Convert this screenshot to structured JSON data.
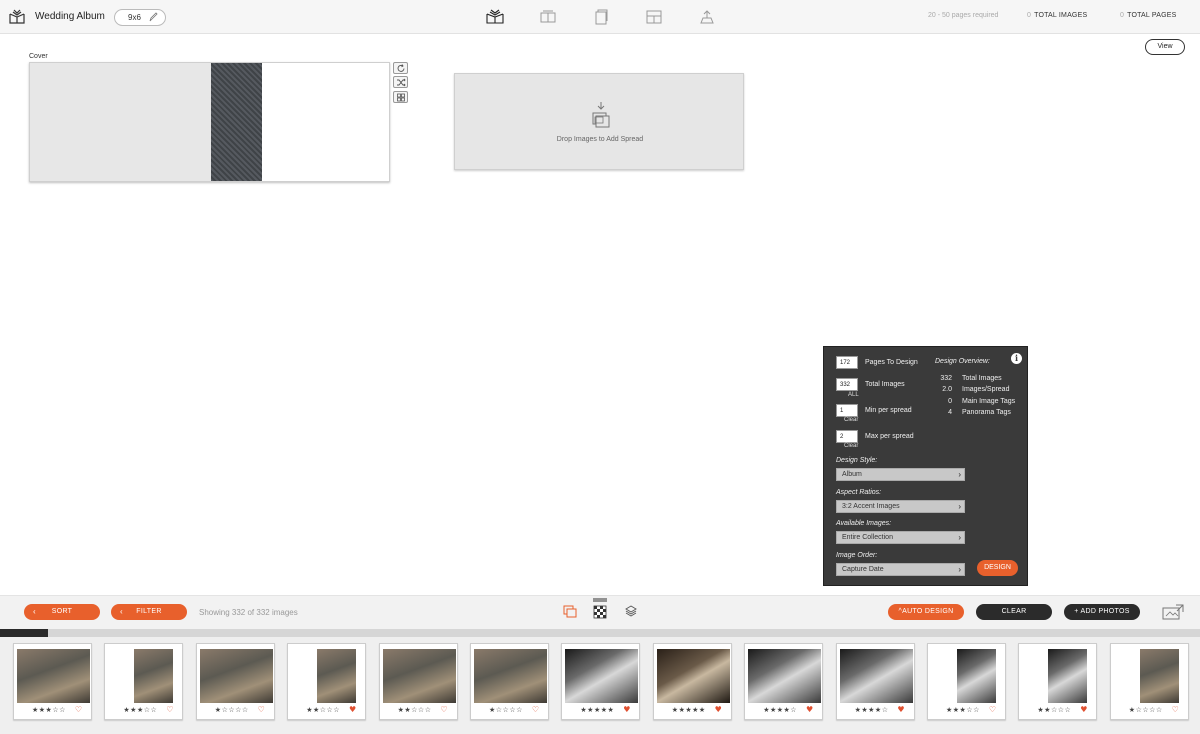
{
  "header": {
    "album_title": "Wedding Album",
    "size": "9x6",
    "pages_required": "20 - 50 pages required",
    "total_images_count": "0",
    "total_images_label": "TOTAL IMAGES",
    "total_pages_count": "0",
    "total_pages_label": "TOTAL PAGES",
    "nav_icons": [
      "album-icon",
      "spread-icon",
      "pages-icon",
      "layout-icon",
      "export-icon"
    ]
  },
  "canvas": {
    "view_label": "View",
    "cover_label": "Cover",
    "drop_text": "Drop Images to Add Spread"
  },
  "design_panel": {
    "pages_to_design_value": "172",
    "pages_to_design_label": "Pages To Design",
    "total_images_value": "332",
    "total_images_sub": "ALL",
    "total_images_label": "Total Images",
    "min_value": "1",
    "min_sub": "Clear",
    "min_label": "Min per spread",
    "max_value": "2",
    "max_sub": "Clear",
    "max_label": "Max per spread",
    "overview_title": "Design Overview:",
    "overview": [
      {
        "value": "332",
        "label": "Total Images"
      },
      {
        "value": "2.0",
        "label": "Images/Spread"
      },
      {
        "value": "0",
        "label": "Main Image Tags"
      },
      {
        "value": "4",
        "label": "Panorama Tags"
      }
    ],
    "design_style_title": "Design Style:",
    "design_style_value": "Album",
    "aspect_title": "Aspect Ratios:",
    "aspect_value": "3:2 Accent Images",
    "available_title": "Available Images:",
    "available_value": "Entire Collection",
    "order_title": "Image Order:",
    "order_value": "Capture Date",
    "design_button": "DESIGN"
  },
  "toolbar": {
    "sort_label": "SORT",
    "filter_label": "FILTER",
    "showing_text": "Showing 332 of 332 images",
    "auto_design_label": "AUTO DESIGN",
    "clear_label": "CLEAR",
    "add_photos_label": "+ ADD PHOTOS",
    "accent_color": "#e8602c"
  },
  "filmstrip": {
    "progress": 0.04,
    "photos": [
      {
        "stars": 3,
        "favorite": false,
        "tone": "color",
        "orientation": "landscape"
      },
      {
        "stars": 3,
        "favorite": false,
        "tone": "color",
        "orientation": "portrait"
      },
      {
        "stars": 1,
        "favorite": false,
        "tone": "color",
        "orientation": "landscape"
      },
      {
        "stars": 2,
        "favorite": true,
        "tone": "color",
        "orientation": "portrait"
      },
      {
        "stars": 2,
        "favorite": false,
        "tone": "color",
        "orientation": "landscape"
      },
      {
        "stars": 1,
        "favorite": false,
        "tone": "color",
        "orientation": "landscape"
      },
      {
        "stars": 5,
        "favorite": true,
        "tone": "bw",
        "orientation": "landscape"
      },
      {
        "stars": 5,
        "favorite": true,
        "tone": "warm",
        "orientation": "landscape"
      },
      {
        "stars": 4,
        "favorite": true,
        "tone": "bw",
        "orientation": "landscape"
      },
      {
        "stars": 4,
        "favorite": true,
        "tone": "bw",
        "orientation": "landscape"
      },
      {
        "stars": 3,
        "favorite": false,
        "tone": "bw",
        "orientation": "portrait"
      },
      {
        "stars": 2,
        "favorite": true,
        "tone": "bw",
        "orientation": "portrait"
      },
      {
        "stars": 1,
        "favorite": false,
        "tone": "color",
        "orientation": "portrait"
      }
    ]
  }
}
